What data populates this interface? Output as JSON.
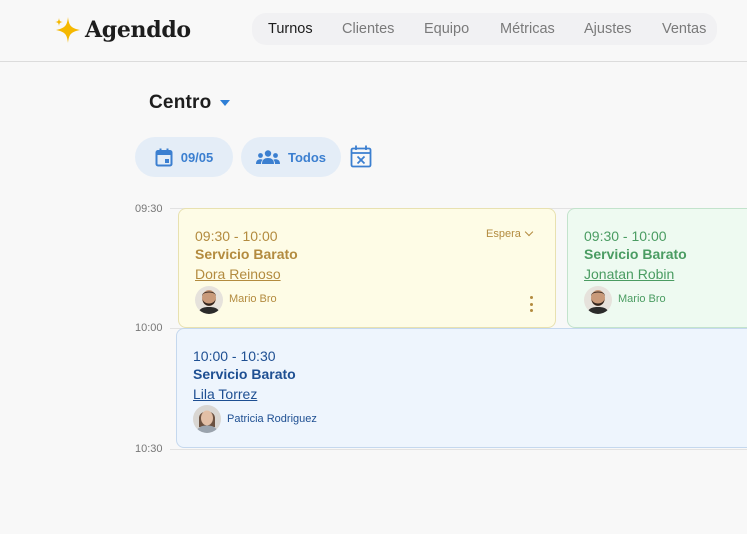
{
  "app": {
    "name": "Agenddo"
  },
  "nav": {
    "tabs": [
      {
        "label": "Turnos",
        "active": true
      },
      {
        "label": "Clientes",
        "active": false
      },
      {
        "label": "Equipo",
        "active": false
      },
      {
        "label": "Métricas",
        "active": false
      },
      {
        "label": "Ajustes",
        "active": false
      },
      {
        "label": "Ventas",
        "active": false
      }
    ]
  },
  "location": {
    "name": "Centro",
    "icon": "caret-down-icon"
  },
  "filters": {
    "date_label": "09/05",
    "date_icon": "calendar-icon",
    "staff_label": "Todos",
    "staff_icon": "people-icon",
    "clear_icon": "calendar-clear-icon"
  },
  "timeline": {
    "slots": [
      "09:30",
      "10:00",
      "10:30"
    ]
  },
  "appointments": [
    {
      "time": "09:30 - 10:00",
      "service": "Servicio Barato",
      "client": "Dora Reinoso",
      "staff": "Mario Bro",
      "status": "Espera",
      "color": "#fefce6"
    },
    {
      "time": "09:30 - 10:00",
      "service": "Servicio Barato",
      "client": "Jonatan Robin",
      "staff": "Mario Bro",
      "color": "#eefaf1"
    },
    {
      "time": "10:00 - 10:30",
      "service": "Servicio Barato",
      "client": "Lila Torrez",
      "staff": "Patricia Rodriguez",
      "color": "#eef5fd"
    }
  ],
  "colors": {
    "accent": "#3b7fd0",
    "logo_star": "#f5b800"
  }
}
